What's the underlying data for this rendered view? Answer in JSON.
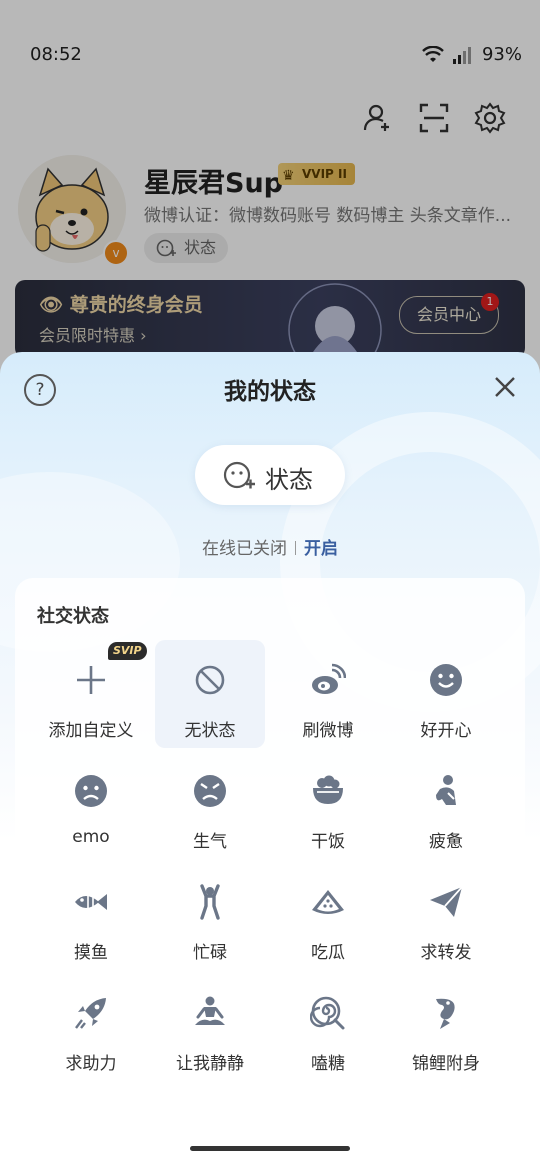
{
  "statusbar": {
    "time": "08:52",
    "battery": "93%"
  },
  "profile": {
    "name": "星辰君Sup",
    "vip_badge": "VVIP II",
    "verification": "微博认证：微博数码账号 数码博主 头条文章作...",
    "status_chip": "状态",
    "avatar_badge": "v"
  },
  "vip_banner": {
    "title": "尊贵的终身会员",
    "subtitle": "会员限时特惠 ›",
    "center_button": "会员中心",
    "notification_count": "1"
  },
  "sheet": {
    "title": "我的状态",
    "status_button": "状态",
    "online_text": "在线已关闭",
    "online_action": "开启",
    "section_title": "社交状态",
    "items": [
      {
        "label": "添加自定义",
        "icon": "plus-icon",
        "tag": "SVIP"
      },
      {
        "label": "无状态",
        "icon": "no-status-icon",
        "selected": true
      },
      {
        "label": "刷微博",
        "icon": "weibo-icon"
      },
      {
        "label": "好开心",
        "icon": "happy-face-icon"
      },
      {
        "label": "emo",
        "icon": "sad-face-icon"
      },
      {
        "label": "生气",
        "icon": "angry-face-icon"
      },
      {
        "label": "干饭",
        "icon": "rice-bowl-icon"
      },
      {
        "label": "疲惫",
        "icon": "tired-person-icon"
      },
      {
        "label": "摸鱼",
        "icon": "fish-icon"
      },
      {
        "label": "忙碌",
        "icon": "busy-person-icon"
      },
      {
        "label": "吃瓜",
        "icon": "watermelon-icon"
      },
      {
        "label": "求转发",
        "icon": "paper-plane-icon"
      },
      {
        "label": "求助力",
        "icon": "rocket-icon"
      },
      {
        "label": "让我静静",
        "icon": "meditation-icon"
      },
      {
        "label": "嗑糖",
        "icon": "lollipop-icon"
      },
      {
        "label": "锦鲤附身",
        "icon": "koi-fish-icon"
      }
    ]
  },
  "colors": {
    "accent_link": "#3a5fa0",
    "icon_gray": "#6b7688",
    "vip_gold": "#f0d9a8"
  }
}
